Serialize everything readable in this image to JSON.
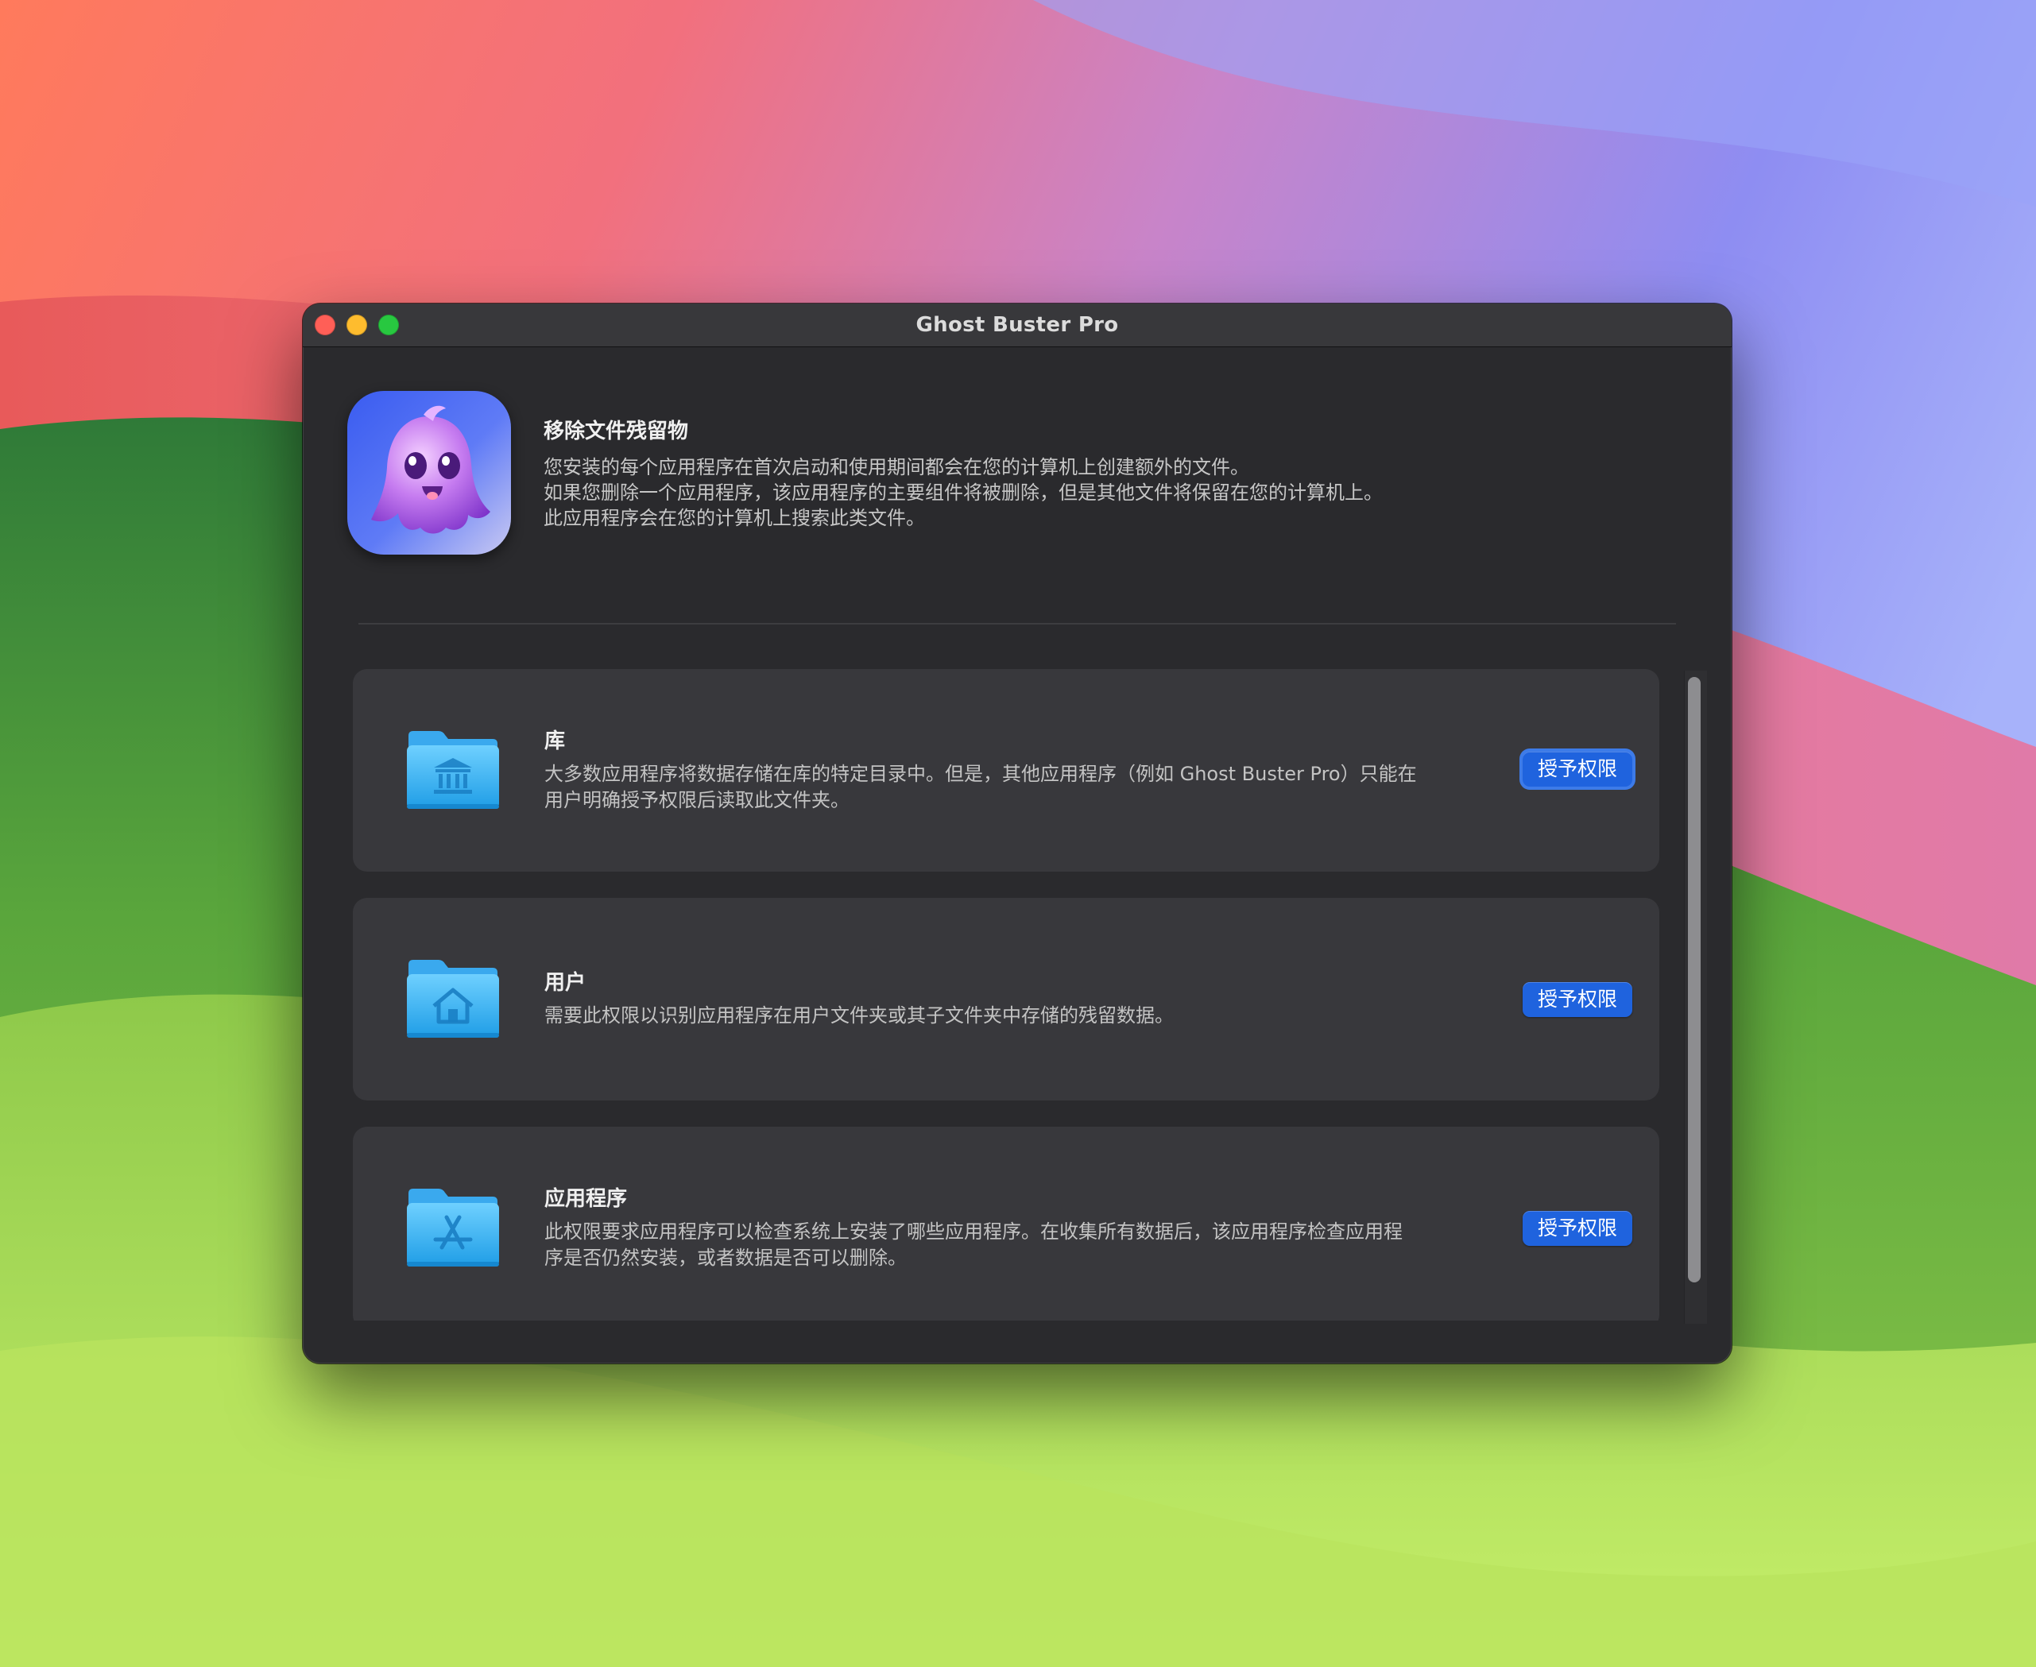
{
  "window": {
    "title": "Ghost Buster Pro"
  },
  "header": {
    "title": "移除文件残留物",
    "description_lines": [
      "您安装的每个应用程序在首次启动和使用期间都会在您的计算机上创建额外的文件。",
      "如果您删除一个应用程序，该应用程序的主要组件将被删除，但是其他文件将保留在您的计算机上。",
      "此应用程序会在您的计算机上搜索此类文件。"
    ]
  },
  "permissions": [
    {
      "title": "库",
      "icon": "library-folder-icon",
      "description_lines": [
        "大多数应用程序将数据存储在库的特定目录中。但是，其他应用程序（例如 Ghost Buster Pro）只能在",
        "用户明确授予权限后读取此文件夹。"
      ],
      "button_label": "授予权限"
    },
    {
      "title": "用户",
      "icon": "home-folder-icon",
      "description_lines": [
        "需要此权限以识别应用程序在用户文件夹或其子文件夹中存储的残留数据。"
      ],
      "button_label": "授予权限"
    },
    {
      "title": "应用程序",
      "icon": "applications-folder-icon",
      "description_lines": [
        "此权限要求应用程序可以检查系统上安装了哪些应用程序。在收集所有数据后，该应用程序检查应用程",
        "序是否仍然安装，或者数据是否可以删除。"
      ],
      "button_label": "授予权限"
    }
  ],
  "colors": {
    "accent_button": "#1f63de",
    "window_bg": "#2a2a2d",
    "card_bg": "#38383c"
  }
}
